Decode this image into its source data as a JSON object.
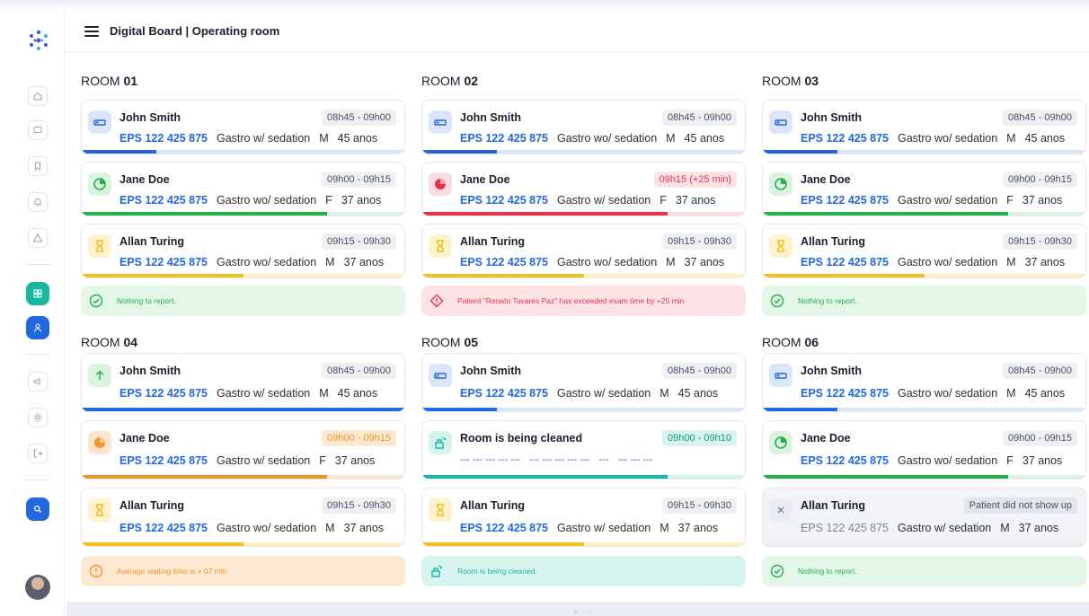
{
  "header": {
    "title": "Digital Board | Operating room"
  },
  "sidebar": {
    "items": [
      "home-icon",
      "chat-icon",
      "bookmark-icon",
      "bell-icon",
      "warning-icon",
      "dashboard-icon",
      "user-icon",
      "megaphone-icon",
      "settings-icon",
      "logout-icon",
      "search-icon"
    ]
  },
  "rooms": [
    {
      "prefix": "ROOM ",
      "num": "01",
      "cards": [
        {
          "name": "John Smith",
          "time": "08h45 - 09h00",
          "eps": "EPS 122 425 875",
          "proc": "Gastro w/ sedation",
          "sex": "M",
          "age": "45 anos",
          "progress": 0.23
        },
        {
          "name": "Jane Doe",
          "time": "09h00 - 09h15",
          "eps": "EPS 122 425 875",
          "proc": "Gastro wo/ sedation",
          "sex": "F",
          "age": "37 anos",
          "progress": 0.76
        },
        {
          "name": "Allan Turing",
          "time": "09h15 - 09h30",
          "eps": "EPS 122 425 875",
          "proc": "Gastro wo/ sedation",
          "sex": "M",
          "age": "37 anos",
          "progress": 0.5
        }
      ],
      "alert": {
        "text": "Nothing to report."
      }
    },
    {
      "prefix": "ROOM ",
      "num": "02",
      "cards": [
        {
          "name": "John Smith",
          "time": "08h45 - 09h00",
          "eps": "EPS 122 425 875",
          "proc": "Gastro wo/ sedation",
          "sex": "M",
          "age": "45 anos",
          "progress": 0.23
        },
        {
          "name": "Jane Doe",
          "time": "09h15 (+25 min)",
          "eps": "EPS 122 425 875",
          "proc": "Gastro w/ sedation",
          "sex": "F",
          "age": "37 anos",
          "progress": 0.76
        },
        {
          "name": "Allan Turing",
          "time": "09h15 - 09h30",
          "eps": "EPS 122 425 875",
          "proc": "Gastro wo/ sedation",
          "sex": "M",
          "age": "37 anos",
          "progress": 0.5
        }
      ],
      "alert": {
        "text": "Patient \"Renato Tavares Paz\" has exceeded exam time by +25 min"
      }
    },
    {
      "prefix": "ROOM ",
      "num": "03",
      "cards": [
        {
          "name": "John Smith",
          "time": "08h45 - 09h00",
          "eps": "EPS 122 425 875",
          "proc": "Gastro wo/ sedation",
          "sex": "M",
          "age": "45 anos",
          "progress": 0.23
        },
        {
          "name": "Jane Doe",
          "time": "09h00 - 09h15",
          "eps": "EPS 122 425 875",
          "proc": "Gastro wo/ sedation",
          "sex": "F",
          "age": "37 anos",
          "progress": 0.76
        },
        {
          "name": "Allan Turing",
          "time": "09h15 - 09h30",
          "eps": "EPS 122 425 875",
          "proc": "Gastro wo/ sedation",
          "sex": "M",
          "age": "37 anos",
          "progress": 0.5
        }
      ],
      "alert": {
        "text": "Nothing to report."
      }
    },
    {
      "prefix": "ROOM ",
      "num": "04",
      "cards": [
        {
          "name": "John Smith",
          "time": "08h45 - 09h00",
          "eps": "EPS 122 425 875",
          "proc": "Gastro w/ sedation",
          "sex": "M",
          "age": "45 anos",
          "progress": 1.0
        },
        {
          "name": "Jane Doe",
          "time": "09h00 - 09h15",
          "eps": "EPS 122 425 875",
          "proc": "Gastro w/ sedation",
          "sex": "F",
          "age": "37 anos",
          "progress": 0.76
        },
        {
          "name": "Allan Turing",
          "time": "09h15 - 09h30",
          "eps": "EPS 122 425 875",
          "proc": "Gastro wo/ sedation",
          "sex": "M",
          "age": "37 anos",
          "progress": 0.5
        }
      ],
      "alert": {
        "text": "Average waiting time is + 07 min"
      }
    },
    {
      "prefix": "ROOM ",
      "num": "05",
      "cards": [
        {
          "name": "John Smith",
          "time": "08h45 - 09h00",
          "eps": "EPS 122 425 875",
          "proc": "Gastro w/ sedation",
          "sex": "M",
          "age": "45 anos",
          "progress": 0.23
        },
        {
          "name": "Room is being cleaned",
          "time": "09h00 - 09h10",
          "eps": "--- --- --- --- ---",
          "proc": "--- --- --- --- ---",
          "sex": "---",
          "age": "--- --- ---",
          "progress": 0.76
        },
        {
          "name": "Allan Turing",
          "time": "09h15 - 09h30",
          "eps": "EPS 122 425 875",
          "proc": "Gastro w/ sedation",
          "sex": "M",
          "age": "37 anos",
          "progress": 0.5
        }
      ],
      "alert": {
        "text": "Room is being cleaned."
      }
    },
    {
      "prefix": "ROOM ",
      "num": "06",
      "cards": [
        {
          "name": "John Smith",
          "time": "08h45 - 09h00",
          "eps": "EPS 122 425 875",
          "proc": "Gastro wo/ sedation",
          "sex": "M",
          "age": "45 anos",
          "progress": 0.23
        },
        {
          "name": "Jane Doe",
          "time": "09h00 - 09h15",
          "eps": "EPS 122 425 875",
          "proc": "Gastro wo/ sedation",
          "sex": "F",
          "age": "37 anos",
          "progress": 0.76
        },
        {
          "name": "Allan Turing",
          "time": "Patient did not show up",
          "eps": "EPS 122 425 875",
          "proc": "Gastro w/ sedation",
          "sex": "M",
          "age": "37 anos",
          "progress": 0.0
        }
      ],
      "alert": {
        "text": "Nothing to report."
      }
    }
  ],
  "colors": {
    "blue": "#2267e0",
    "green": "#22b04b",
    "red": "#e6324b",
    "yellow": "#f2c020",
    "orange": "#f59323",
    "teal": "#17b8a0",
    "gray": "#c9ced8"
  }
}
